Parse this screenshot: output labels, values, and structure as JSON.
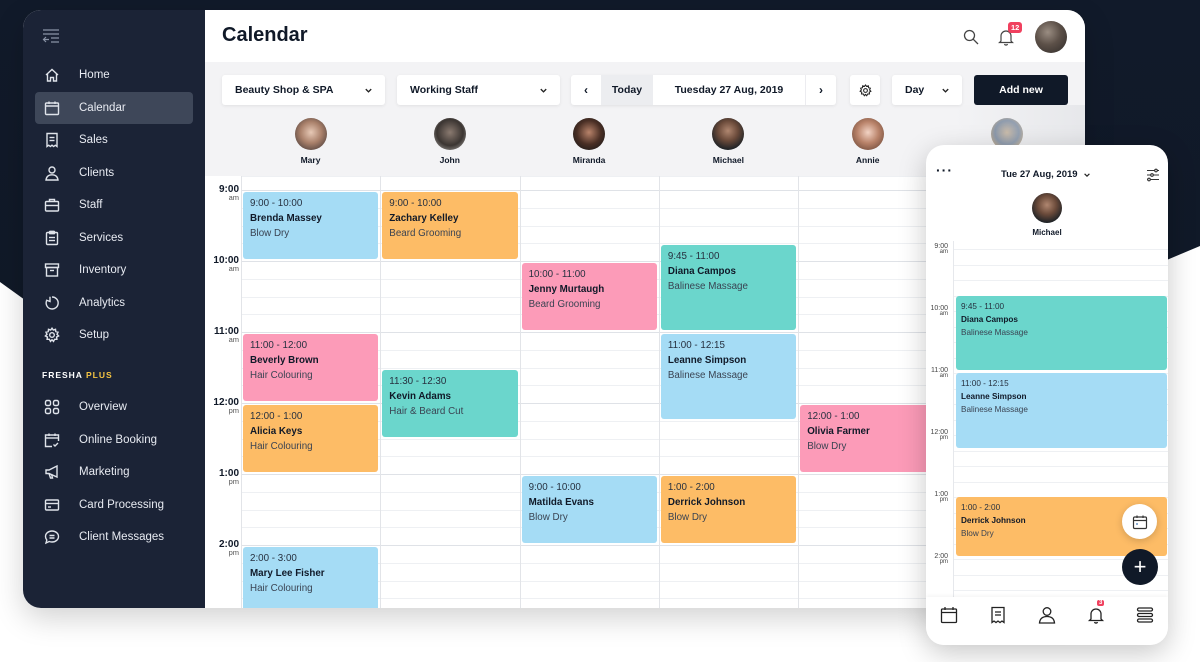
{
  "sidebar": {
    "items": [
      {
        "label": "Home",
        "icon": "home-icon"
      },
      {
        "label": "Calendar",
        "icon": "calendar-icon",
        "active": true
      },
      {
        "label": "Sales",
        "icon": "receipt-icon"
      },
      {
        "label": "Clients",
        "icon": "user-icon"
      },
      {
        "label": "Staff",
        "icon": "briefcase-icon"
      },
      {
        "label": "Services",
        "icon": "clipboard-icon"
      },
      {
        "label": "Inventory",
        "icon": "archive-icon"
      },
      {
        "label": "Analytics",
        "icon": "pie-chart-icon"
      },
      {
        "label": "Setup",
        "icon": "gear-icon"
      }
    ],
    "section": {
      "label": "FRESHA",
      "highlight": "PLUS",
      "highlight_color": "#f5c442"
    },
    "plus_items": [
      {
        "label": "Overview",
        "icon": "grid-icon"
      },
      {
        "label": "Online Booking",
        "icon": "calendar-check-icon"
      },
      {
        "label": "Marketing",
        "icon": "megaphone-icon"
      },
      {
        "label": "Card Processing",
        "icon": "credit-card-icon"
      },
      {
        "label": "Client Messages",
        "icon": "chat-icon"
      }
    ]
  },
  "header": {
    "title": "Calendar",
    "notifications_count": "12"
  },
  "toolbar": {
    "location": "Beauty Shop & SPA",
    "staff_filter": "Working Staff",
    "prev": "‹",
    "today": "Today",
    "date": "Tuesday 27 Aug, 2019",
    "next": "›",
    "view": "Day",
    "add_new": "Add new"
  },
  "staff": [
    {
      "name": "Mary"
    },
    {
      "name": "John"
    },
    {
      "name": "Miranda"
    },
    {
      "name": "Michael"
    },
    {
      "name": "Annie"
    },
    {
      "name": ""
    }
  ],
  "times": [
    {
      "h": "9:00",
      "ap": "am"
    },
    {
      "h": "10:00",
      "ap": "am"
    },
    {
      "h": "11:00",
      "ap": "am"
    },
    {
      "h": "12:00",
      "ap": "pm"
    },
    {
      "h": "1:00",
      "ap": "pm"
    },
    {
      "h": "2:00",
      "ap": "pm"
    }
  ],
  "appointments": [
    {
      "staff": 0,
      "start": 9.0,
      "end": 10.0,
      "time": "9:00 - 10:00",
      "client": "Brenda Massey",
      "service": "Blow Dry",
      "color": "blue"
    },
    {
      "staff": 0,
      "start": 11.0,
      "end": 12.0,
      "time": "11:00 - 12:00",
      "client": "Beverly Brown",
      "service": "Hair Colouring",
      "color": "pink"
    },
    {
      "staff": 0,
      "start": 12.0,
      "end": 13.0,
      "time": "12:00 - 1:00",
      "client": "Alicia Keys",
      "service": "Hair Colouring",
      "color": "orange"
    },
    {
      "staff": 0,
      "start": 14.0,
      "end": 15.0,
      "time": "2:00 - 3:00",
      "client": "Mary Lee Fisher",
      "service": "Hair Colouring",
      "color": "blue"
    },
    {
      "staff": 1,
      "start": 9.0,
      "end": 10.0,
      "time": "9:00 - 10:00",
      "client": "Zachary Kelley",
      "service": "Beard Grooming",
      "color": "orange"
    },
    {
      "staff": 1,
      "start": 11.5,
      "end": 12.5,
      "time": "11:30 - 12:30",
      "client": "Kevin Adams",
      "service": "Hair & Beard Cut",
      "color": "teal"
    },
    {
      "staff": 2,
      "start": 10.0,
      "end": 11.0,
      "time": "10:00 - 11:00",
      "client": "Jenny Murtaugh",
      "service": "Beard Grooming",
      "color": "pink"
    },
    {
      "staff": 2,
      "start": 13.0,
      "end": 14.0,
      "time": "9:00 - 10:00",
      "client": "Matilda Evans",
      "service": "Blow Dry",
      "color": "blue"
    },
    {
      "staff": 3,
      "start": 9.75,
      "end": 11.0,
      "time": "9:45 - 11:00",
      "client": "Diana Campos",
      "service": "Balinese Massage",
      "color": "teal"
    },
    {
      "staff": 3,
      "start": 11.0,
      "end": 12.25,
      "time": "11:00 - 12:15",
      "client": "Leanne Simpson",
      "service": "Balinese Massage",
      "color": "blue"
    },
    {
      "staff": 3,
      "start": 13.0,
      "end": 14.0,
      "time": "1:00 - 2:00",
      "client": "Derrick Johnson",
      "service": "Blow Dry",
      "color": "orange"
    },
    {
      "staff": 4,
      "start": 12.0,
      "end": 13.0,
      "time": "12:00 - 1:00",
      "client": "Olivia Farmer",
      "service": "Blow Dry",
      "color": "pink"
    }
  ],
  "mobile": {
    "date": "Tue 27 Aug, 2019",
    "staff_name": "Michael",
    "times": [
      {
        "h": "9:00",
        "ap": "am"
      },
      {
        "h": "10:00",
        "ap": "am"
      },
      {
        "h": "11:00",
        "ap": "am"
      },
      {
        "h": "12:00",
        "ap": "pm"
      },
      {
        "h": "1:00",
        "ap": "pm"
      },
      {
        "h": "2:00",
        "ap": "pm"
      }
    ],
    "appointments": [
      {
        "start": 9.75,
        "end": 11.0,
        "time": "9:45 - 11:00",
        "client": "Diana Campos",
        "service": "Balinese Massage",
        "color": "teal"
      },
      {
        "start": 11.0,
        "end": 12.25,
        "time": "11:00 - 12:15",
        "client": "Leanne Simpson",
        "service": "Balinese Massage",
        "color": "blue"
      },
      {
        "start": 13.0,
        "end": 14.0,
        "time": "1:00 - 2:00",
        "client": "Derrick Johnson",
        "service": "Blow Dry",
        "color": "orange"
      }
    ],
    "add_label": "+",
    "tab_notifications_count": "3",
    "tabs": [
      "calendar-tab",
      "sales-tab",
      "clients-tab",
      "notifications-tab",
      "menu-tab"
    ]
  }
}
